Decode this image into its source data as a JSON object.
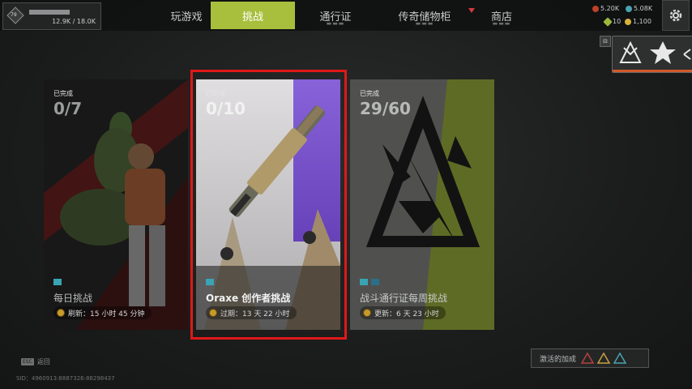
{
  "player": {
    "level": "79",
    "xp": "12.9K / 18.0K"
  },
  "tabs": [
    {
      "label": "玩游戏",
      "active": false
    },
    {
      "label": "挑战",
      "active": true
    },
    {
      "label": "通行证",
      "active": false
    },
    {
      "label": "传奇储物柜",
      "active": false,
      "notification": true
    },
    {
      "label": "商店",
      "active": false
    }
  ],
  "currencies": {
    "crafting": "5.20K",
    "coins": "5.08K",
    "legend_tokens": "10",
    "apex_coins": "1,100"
  },
  "cards": [
    {
      "completed_label": "已完成",
      "progress": "0/7",
      "title": "每日挑战",
      "timer": "刷新：15 小时 45 分钟",
      "selected": false
    },
    {
      "completed_label": "已完成",
      "progress": "0/10",
      "title": "Oraxe 创作者挑战",
      "timer": "过期：13 天 22 小时",
      "selected": true
    },
    {
      "completed_label": "已完成",
      "progress": "29/60",
      "title": "战斗通行证每周挑战",
      "timer": "更新：6 天 23 小时",
      "selected": false
    }
  ],
  "footer": {
    "esc_key": "ESC",
    "back_label": "返回",
    "sid": "SID：4960913:8887326:88298437",
    "active_boosts_label": "激活的加成"
  },
  "colors": {
    "accent_green": "#a7bf3c",
    "selection_red": "#e01818",
    "purple": "#6a3bd0"
  }
}
